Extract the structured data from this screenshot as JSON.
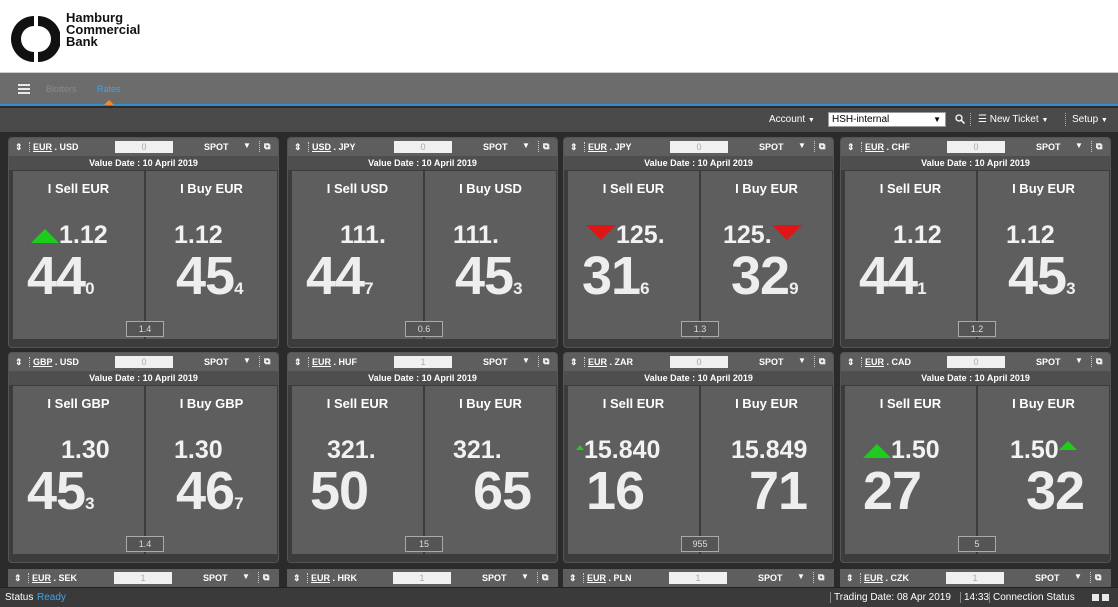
{
  "brand": {
    "line1": "Hamburg",
    "line2": "Commercial",
    "line3": "Bank"
  },
  "nav": {
    "tabs": [
      {
        "label": "Blotters"
      },
      {
        "label": "Rates",
        "active": true
      }
    ]
  },
  "toolbar": {
    "account_label": "Account",
    "account_value": "HSH-internal",
    "new_ticket_label": "New Ticket",
    "setup_label": "Setup"
  },
  "tiles": [
    {
      "pair": {
        "ccy1": "EUR",
        "ccy2": "USD"
      },
      "amount": "0",
      "tenor": "SPOT",
      "value_date": "Value Date : 10 April 2019",
      "sell": {
        "label": "I Sell EUR",
        "big": "1.12",
        "pips": "44",
        "pip_small": "0",
        "trend": "up"
      },
      "buy": {
        "label": "I Buy EUR",
        "big": "1.12",
        "pips": "45",
        "pip_small": "4",
        "trend": ""
      },
      "spread": "1.4"
    },
    {
      "pair": {
        "ccy1": "USD",
        "ccy2": "JPY"
      },
      "amount": "0",
      "tenor": "SPOT",
      "value_date": "Value Date : 10 April 2019",
      "sell": {
        "label": "I Sell USD",
        "big": "111.",
        "pips": "44",
        "pip_small": "7",
        "trend": ""
      },
      "buy": {
        "label": "I Buy USD",
        "big": "111.",
        "pips": "45",
        "pip_small": "3",
        "trend": ""
      },
      "spread": "0.6"
    },
    {
      "pair": {
        "ccy1": "EUR",
        "ccy2": "JPY"
      },
      "amount": "0",
      "tenor": "SPOT",
      "value_date": "Value Date : 10 April 2019",
      "sell": {
        "label": "I Sell EUR",
        "big": "125.",
        "pips": "31",
        "pip_small": "6",
        "trend": "down"
      },
      "buy": {
        "label": "I Buy EUR",
        "big": "125.",
        "pips": "32",
        "pip_small": "9",
        "trend": "down"
      },
      "spread": "1.3"
    },
    {
      "pair": {
        "ccy1": "EUR",
        "ccy2": "CHF"
      },
      "amount": "0",
      "tenor": "SPOT",
      "value_date": "Value Date : 10 April 2019",
      "sell": {
        "label": "I Sell EUR",
        "big": "1.12",
        "pips": "44",
        "pip_small": "1",
        "trend": ""
      },
      "buy": {
        "label": "I Buy EUR",
        "big": "1.12",
        "pips": "45",
        "pip_small": "3",
        "trend": ""
      },
      "spread": "1.2"
    },
    {
      "pair": {
        "ccy1": "GBP",
        "ccy2": "USD"
      },
      "amount": "0",
      "tenor": "SPOT",
      "value_date": "Value Date : 10 April 2019",
      "sell": {
        "label": "I Sell GBP",
        "big": "1.30",
        "pips": "45",
        "pip_small": "3",
        "trend": ""
      },
      "buy": {
        "label": "I Buy GBP",
        "big": "1.30",
        "pips": "46",
        "pip_small": "7",
        "trend": ""
      },
      "spread": "1.4"
    },
    {
      "pair": {
        "ccy1": "EUR",
        "ccy2": "HUF"
      },
      "amount": "1",
      "tenor": "SPOT",
      "value_date": "Value Date : 10 April 2019",
      "sell": {
        "label": "I Sell EUR",
        "big": "321.",
        "pips": "50",
        "pip_small": "",
        "trend": ""
      },
      "buy": {
        "label": "I Buy EUR",
        "big": "321.",
        "pips": "65",
        "pip_small": "",
        "trend": ""
      },
      "spread": "15"
    },
    {
      "pair": {
        "ccy1": "EUR",
        "ccy2": "ZAR"
      },
      "amount": "0",
      "tenor": "SPOT",
      "value_date": "Value Date : 10 April 2019",
      "sell": {
        "label": "I Sell EUR",
        "big": "15.840",
        "pips": "16",
        "pip_small": "",
        "trend": "up-small"
      },
      "buy": {
        "label": "I Buy EUR",
        "big": "15.849",
        "pips": "71",
        "pip_small": "",
        "trend": ""
      },
      "spread": "955"
    },
    {
      "pair": {
        "ccy1": "EUR",
        "ccy2": "CAD"
      },
      "amount": "0",
      "tenor": "SPOT",
      "value_date": "Value Date : 10 April 2019",
      "sell": {
        "label": "I Sell EUR",
        "big": "1.50",
        "pips": "27",
        "pip_small": "",
        "trend": "up"
      },
      "buy": {
        "label": "I Buy EUR",
        "big": "1.50",
        "pips": "32",
        "pip_small": "",
        "trend": "up-right"
      },
      "spread": "5"
    }
  ],
  "partial_tiles": [
    {
      "pair": {
        "ccy1": "EUR",
        "ccy2": "SEK"
      },
      "amount": "1",
      "tenor": "SPOT"
    },
    {
      "pair": {
        "ccy1": "EUR",
        "ccy2": "HRK"
      },
      "amount": "1",
      "tenor": "SPOT"
    },
    {
      "pair": {
        "ccy1": "EUR",
        "ccy2": "PLN"
      },
      "amount": "1",
      "tenor": "SPOT"
    },
    {
      "pair": {
        "ccy1": "EUR",
        "ccy2": "CZK"
      },
      "amount": "1",
      "tenor": "SPOT"
    }
  ],
  "status": {
    "label": "Status",
    "value": "Ready",
    "trading_date": "Trading Date: 08 Apr 2019",
    "time": "14:33",
    "connection_label": "Connection Status"
  },
  "colors": {
    "accent": "#2f8ed0",
    "up": "#1dcc1d",
    "down": "#e01515",
    "indicator": "#f08a2c"
  }
}
